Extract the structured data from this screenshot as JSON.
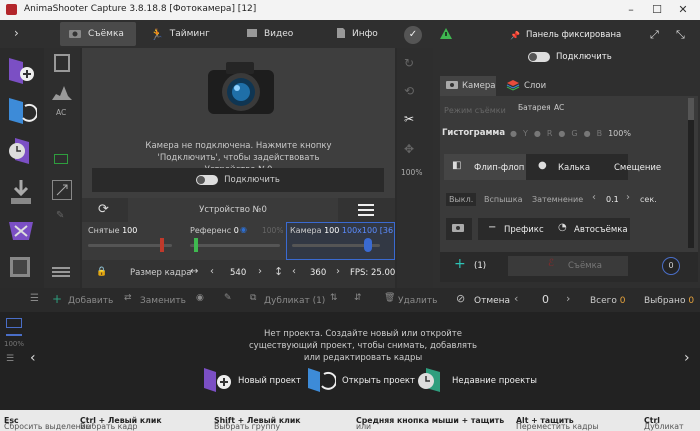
{
  "window": {
    "title": "AnimaShooter Capture 3.8.18.8 [Фотокамера] [12]"
  },
  "tabs": [
    {
      "label": "Съёмка",
      "icon": "camera-icon"
    },
    {
      "label": "Тайминг",
      "icon": "running-man-icon"
    },
    {
      "label": "Видео",
      "icon": "film-icon"
    },
    {
      "label": "Инфо",
      "icon": "document-icon"
    }
  ],
  "viewer": {
    "message": "Камера не подключена. Нажмите кнопку 'Подключить', чтобы задействовать Устройство №0",
    "connect_label": "Подключить",
    "device_label": "Устройство №0",
    "percent_label": "100%",
    "ac_label": "AC"
  },
  "layers": {
    "captured": {
      "label": "Снятые",
      "value": "100"
    },
    "reference": {
      "label": "Референс",
      "value": "0"
    },
    "reference_pct": "100%",
    "camera": {
      "label": "Камера",
      "value": "100",
      "resolution": "100x100",
      "extra": "[36"
    }
  },
  "framebar": {
    "size_label": "Размер кадра",
    "width": "540",
    "height": "360",
    "fps": "FPS: 25.00"
  },
  "right_panel": {
    "pin_label": "Панель фиксирована",
    "connect_label": "Подключить",
    "tab_camera": "Камера",
    "tab_layers": "Слои",
    "mode_label": "Режим съёмки",
    "battery_label": "Батарея",
    "battery_value": "AC",
    "histogram_label": "Гистограмма",
    "hist_channels": [
      "Y",
      "R",
      "G",
      "B"
    ],
    "hist_pct": "100%",
    "flipflop_label": "Флип-флоп",
    "onion_label": "Калька",
    "shift_label": "Смещение",
    "flash_off": "Выкл.",
    "flash_label": "Вспышка",
    "dim_label": "Затемнение",
    "dim_value": "0.1",
    "sec_label": "сек.",
    "prefix_label": "Префикс",
    "autocapture_label": "Автосъёмка",
    "counter_label": "(1)",
    "shoot_label": "Съёмка",
    "shoot_count": "0"
  },
  "actions": {
    "add": "Добавить",
    "replace": "Заменить",
    "duplicate": "Дубликат (1)",
    "delete": "Удалить",
    "cancel": "Отмена",
    "counter": "0",
    "total_label": "Всего",
    "total_value": "0",
    "selected_label": "Выбрано",
    "selected_value": "0"
  },
  "timeline": {
    "zoom": "100%",
    "empty_message": "Нет проекта. Создайте новый или откройте существующий проект, чтобы снимать, добавлять или редактировать кадры",
    "new_project": "Новый проект",
    "open_project": "Открыть проект",
    "recent_projects": "Недавние проекты"
  },
  "statusbar": [
    {
      "text": "Сбросить выделение",
      "key": "Esc"
    },
    {
      "text": "Выбрать кадр",
      "key": "Ctrl + Левый клик"
    },
    {
      "text": "Выбрать группу",
      "key": "Shift + Левый клик"
    },
    {
      "text": "или",
      "key": "Средняя кнопка мыши + тащить"
    },
    {
      "text": "Переместить кадры",
      "key": "Alt + тащить"
    },
    {
      "text": "Дубликат",
      "key": "Ctrl"
    }
  ],
  "colors": {
    "accent": "#4a6ec7",
    "purple": "#7b4fc4",
    "red": "#c0392b",
    "green": "#3fb950"
  }
}
